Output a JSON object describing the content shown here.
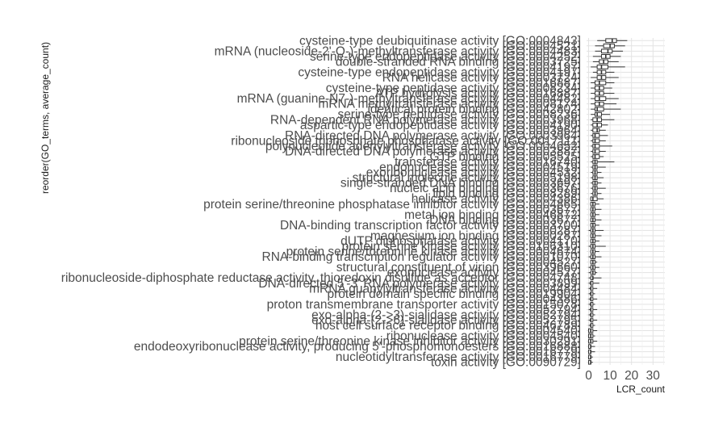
{
  "chart_data": {
    "type": "boxplot",
    "orientation": "horizontal",
    "xlabel": "LCR_count",
    "ylabel": "reorder(GO_terms, average_count)",
    "xlim": [
      0,
      35
    ],
    "xticks": [
      "0",
      "10",
      "20",
      "30"
    ],
    "grid": true,
    "categories_top_to_bottom": [
      "cysteine-type deubiquitinase activity [GO:0004843]",
      "[GO:0004521]",
      "mRNA (nucleoside-2'-O-)-methyltransferase activity [GO:0004483]",
      "serine-type endopeptidase activity [GO:0004252]",
      "double-stranded RNA binding [GO:0003725]",
      "[GO:0004197]",
      "cysteine-type endopeptidase activity [GO:0004197]",
      "RNA helicase activity [GO:0003724]",
      "[GO:0016887]",
      "cysteine-type peptidase activity [GO:0008234]",
      "ATP hydrolysis activity [GO:0016887]",
      "mRNA (guanine-N7-)-methyltransferase activity [GO:0004482]",
      "mRNA methyltransferase activity [GO:0008174]",
      "identical protein binding [GO:0042802]",
      "serine-type peptidase activity [GO:0008236]",
      "RNA-dependent RNA polymerase activity [GO:0003968]",
      "aspartic-type endopeptidase activity [GO:0004190]",
      "[GO:0003964]",
      "RNA-directed DNA polymerase activity [GO:0003964]",
      "ribonucleoside triphosphate phosphatase activity [GO:0017111]",
      "polynucleotide adenylyltransferase activity [GO:0004652]",
      "DNA-directed DNA polymerase activity [GO:0003887]",
      "GTP binding [GO:0005525]",
      "transferase activity [GO:0016740]",
      "endonuclease activity [GO:0004519]",
      "exoribonuclease activity [GO:0004532]",
      "structural molecule activity [GO:0005198]",
      "single-stranded DNA binding [GO:0003697]",
      "nucleic acid binding [GO:0003676]",
      "lipid binding [GO:0008289]",
      "helicase activity [GO:0004386]",
      "protein serine/threonine phosphatase inhibitor activity [GO:0004865]",
      "[GO:0003677]",
      "metal ion binding [GO:0046872]",
      "DNA binding [GO:0003677]",
      "DNA-binding transcription factor activity [GO:0003700]",
      "[GO:0000287]",
      "magnesium ion binding [GO:0000287]",
      "dUTP diphosphatase activity [GO:0004170]",
      "protein serine kinase activity [GO:0106310]",
      "protein serine/threonine kinase activity [GO:0004674]",
      "RNA-binding transcription regulator activity [GO:0001070]",
      "[GO:0004527]",
      "structural constituent of virion [GO:0039660]",
      "exonuclease activity [GO:0004527]",
      "ribonucleoside-diphosphate reductase activity, thioredoxin disulfide as acceptor [GO:0004748]",
      "DNA-directed 5'-3' RNA polymerase activity [GO:0003899]",
      "mRNA guanylyltransferase activity [GO:0004484]",
      "protein domain specific binding [GO:0019904]",
      "[GO:0004386]",
      "proton transmembrane transporter activity [GO:0015078]",
      "[GO:0052794]",
      "exo-alpha-(2->3)-sialidase activity [GO:0052794]",
      "exo-alpha-(2->6)-sialidase activity [GO:0052795]",
      "host cell surface receptor binding [GO:0046789]",
      "[GO:0004540]",
      "ribonuclease activity [GO:0004540]",
      "protein serine/threonine kinase inhibitor activity [GO:0030291]",
      "endodeoxyribonuclease activity, producing 5'-phosphomonoesters [GO:0016888]",
      "[GO:0016779]",
      "nucleotidyltransferase activity [GO:0016779]",
      "toxin activity [GO:0090729]"
    ],
    "series": [
      {
        "stat_order": [
          "whisker_low",
          "q1",
          "median",
          "q3",
          "whisker_high"
        ],
        "values": [
          [
            4,
            8,
            11,
            13,
            18
          ],
          [
            3,
            7,
            10,
            12,
            17
          ],
          [
            3,
            6,
            9,
            11,
            16
          ],
          [
            2,
            6,
            8,
            10,
            15
          ],
          [
            2,
            5,
            7,
            9,
            14
          ],
          [
            1,
            4,
            6,
            9,
            17
          ],
          [
            2,
            4,
            6,
            8,
            12
          ],
          [
            1,
            4,
            6,
            8,
            14
          ],
          [
            1,
            3,
            5,
            8,
            12
          ],
          [
            1,
            3,
            5,
            7,
            11
          ],
          [
            1,
            3,
            5,
            7,
            12
          ],
          [
            1,
            3,
            5,
            8,
            14
          ],
          [
            1,
            3,
            5,
            7,
            13
          ],
          [
            1,
            3,
            4,
            7,
            15
          ],
          [
            1,
            3,
            4,
            6,
            10
          ],
          [
            1,
            2,
            4,
            6,
            12
          ],
          [
            1,
            2,
            4,
            6,
            9
          ],
          [
            1,
            2,
            4,
            5,
            8
          ],
          [
            1,
            2,
            3,
            5,
            9
          ],
          [
            1,
            2,
            3,
            5,
            8
          ],
          [
            1,
            2,
            3,
            5,
            11
          ],
          [
            1,
            2,
            3,
            5,
            8
          ],
          [
            1,
            2,
            3,
            5,
            7
          ],
          [
            1,
            2,
            3,
            4,
            12
          ],
          [
            1,
            2,
            3,
            4,
            8
          ],
          [
            1,
            2,
            3,
            4,
            6
          ],
          [
            1,
            2,
            3,
            4,
            7
          ],
          [
            1,
            2,
            3,
            4,
            6
          ],
          [
            1,
            2,
            3,
            4,
            8
          ],
          [
            1,
            2,
            3,
            4,
            6
          ],
          [
            1,
            1,
            2,
            4,
            7
          ],
          [
            1,
            1,
            2,
            3,
            5
          ],
          [
            1,
            1,
            2,
            3,
            6
          ],
          [
            1,
            1,
            2,
            3,
            5
          ],
          [
            1,
            1,
            2,
            3,
            6
          ],
          [
            1,
            1,
            2,
            3,
            5
          ],
          [
            0,
            1,
            2,
            3,
            7
          ],
          [
            1,
            1,
            2,
            3,
            6
          ],
          [
            1,
            1,
            2,
            3,
            5
          ],
          [
            0,
            1,
            2,
            3,
            8
          ],
          [
            1,
            1,
            2,
            3,
            5
          ],
          [
            0,
            1,
            2,
            3,
            6
          ],
          [
            1,
            1,
            2,
            3,
            4
          ],
          [
            0,
            1,
            2,
            3,
            5
          ],
          [
            0,
            1,
            2,
            3,
            4
          ],
          [
            0,
            1,
            2,
            2,
            6
          ],
          [
            0,
            1,
            1,
            2,
            5
          ],
          [
            0,
            1,
            1,
            2,
            4
          ],
          [
            0,
            1,
            1,
            2,
            3
          ],
          [
            0,
            1,
            1,
            2,
            4
          ],
          [
            0,
            1,
            1,
            2,
            3
          ],
          [
            0,
            1,
            1,
            2,
            4
          ],
          [
            0,
            1,
            1,
            2,
            3
          ],
          [
            0,
            1,
            1,
            2,
            4
          ],
          [
            0,
            1,
            1,
            2,
            3
          ],
          [
            0,
            0,
            1,
            2,
            4
          ],
          [
            0,
            0,
            1,
            2,
            3
          ],
          [
            0,
            0,
            1,
            2,
            4
          ],
          [
            0,
            0,
            1,
            1,
            3
          ],
          [
            0,
            0,
            1,
            1,
            3
          ],
          [
            0,
            0,
            1,
            1,
            2
          ],
          [
            0,
            0,
            1,
            1,
            2
          ]
        ]
      }
    ]
  }
}
